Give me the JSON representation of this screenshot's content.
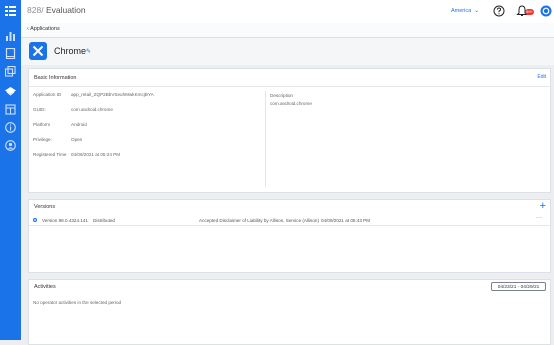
{
  "header": {
    "org": "828",
    "separator": "/",
    "title": "Evaluation",
    "region": "America",
    "notification_count": "99+"
  },
  "subnav": {
    "back_label": "Applications"
  },
  "app": {
    "name": "Chrome"
  },
  "basic_info": {
    "title": "Basic Information",
    "edit_label": "Edit",
    "fields": [
      {
        "label": "Application ID",
        "value": "app_retail_ZQP2BbVSeuhMwkKmcjBYA"
      },
      {
        "label": "GUID:",
        "value": "com.android.chrome"
      },
      {
        "label": "Platform",
        "value": "Android"
      },
      {
        "label": "Privilege:",
        "value": "Open"
      },
      {
        "label": "Registered Time",
        "value": "04/09/2021 at 05:24 PM"
      }
    ],
    "description_label": "Description",
    "description_value": "com.android.chrome"
  },
  "versions": {
    "title": "Versions",
    "rows": [
      {
        "version": "Version 88.0.4324.141",
        "status": "Distributed",
        "note": "Accepted Disclaimer of Liability by Allison, Service (Allison)",
        "time": "04/09/2021 at 05:43 PM"
      }
    ]
  },
  "activities": {
    "title": "Activities",
    "date_range": "04/23/21 - 04/29/21",
    "empty_text": "No operator activities in the selected period"
  },
  "colors": {
    "accent": "#1a73e8",
    "badge": "#e53935"
  },
  "icons": {
    "sidebar": [
      "menu-icon",
      "bar-chart-icon",
      "device-icon",
      "layers-icon",
      "apps-icon",
      "store-icon",
      "info-icon",
      "person-icon"
    ],
    "topbar": [
      "help-icon",
      "bell-icon",
      "account-icon"
    ]
  }
}
